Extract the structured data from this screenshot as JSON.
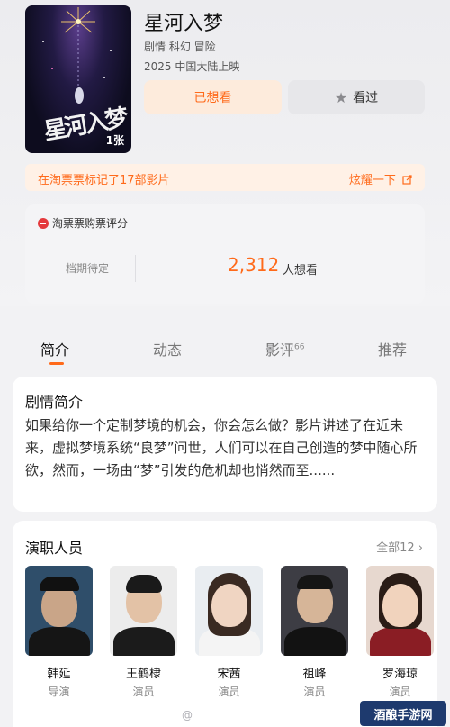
{
  "movie": {
    "title": "星河入梦",
    "genres": "剧情 科幻 冒险",
    "release": "2025 中国大陆上映",
    "poster_count": "1张",
    "poster_calligraphy": "星河入梦"
  },
  "actions": {
    "want_label": "已想看",
    "seen_label": "看过"
  },
  "mark_bar": {
    "text": "在淘票票标记了17部影片",
    "link": "炫耀一下"
  },
  "rating": {
    "header": "淘票票购票评分",
    "status": "档期待定",
    "want_count": "2,312",
    "want_suffix": "人想看"
  },
  "tabs": [
    {
      "label": "简介",
      "active": true
    },
    {
      "label": "动态"
    },
    {
      "label": "影评",
      "badge": "66"
    },
    {
      "label": "推荐"
    }
  ],
  "synopsis": {
    "title": "剧情简介",
    "text": "如果给你一个定制梦境的机会，你会怎么做？影片讲述了在近未来，虚拟梦境系统“良梦”问世，人们可以在自己创造的梦中随心所欲，然而，一场由“梦”引发的危机却也悄然而至......"
  },
  "cast": {
    "title": "演职人员",
    "all_label": "全部12",
    "members": [
      {
        "name": "韩延",
        "role": "导演"
      },
      {
        "name": "王鹤棣",
        "role": "演员"
      },
      {
        "name": "宋茜",
        "role": "演员"
      },
      {
        "name": "祖峰",
        "role": "演员"
      },
      {
        "name": "罗海琼",
        "role": "演员"
      }
    ]
  },
  "footer": {
    "watermark": "@",
    "site_logo": "酒酿手游网"
  },
  "colors": {
    "accent": "#ff6a1a",
    "want_bg": "#fdebdc",
    "background": "#f2f2f4"
  }
}
